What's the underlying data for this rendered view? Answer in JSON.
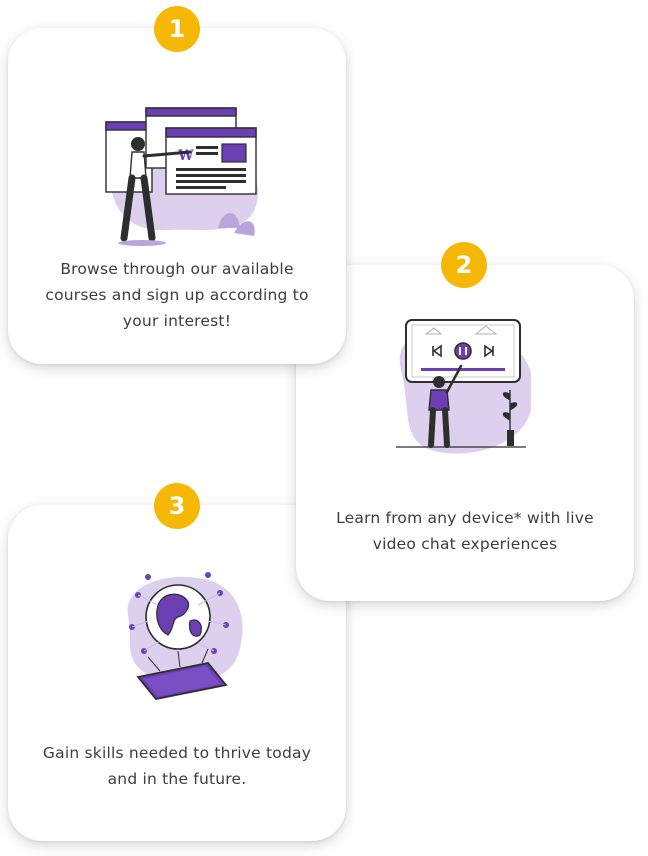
{
  "colors": {
    "accent_yellow": "#f6b705",
    "brand_purple": "#6c3fb5",
    "light_purple": "#ddd0ee",
    "text_dark": "#3c3c44"
  },
  "steps": [
    {
      "number": "1",
      "text": "Browse through our available courses and sign up according to your interest!",
      "illustration_icon": "browse-courses-illustration-icon"
    },
    {
      "number": "2",
      "text": "Learn from any device* with live video chat experiences",
      "illustration_icon": "video-learning-illustration-icon"
    },
    {
      "number": "3",
      "text": "Gain skills needed to thrive today and in the future.",
      "illustration_icon": "global-skills-illustration-icon"
    }
  ]
}
